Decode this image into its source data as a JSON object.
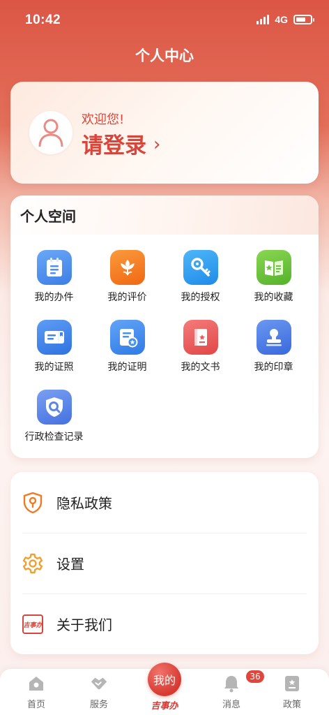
{
  "status": {
    "time": "10:42",
    "network": "4G",
    "battery_level": 0.7
  },
  "header": {
    "title": "个人中心"
  },
  "login": {
    "greeting": "欢迎您!",
    "action": "请登录",
    "arrow": "›"
  },
  "space": {
    "title": "个人空间",
    "items": [
      {
        "label": "我的办件",
        "icon": "document-list-icon",
        "color": "#4f8ff0"
      },
      {
        "label": "我的评价",
        "icon": "flower-icon",
        "color": "#f4781f"
      },
      {
        "label": "我的授权",
        "icon": "key-icon",
        "color": "#2f9ef0"
      },
      {
        "label": "我的收藏",
        "icon": "bookmark-book-icon",
        "color": "#6cc23a"
      },
      {
        "label": "我的证照",
        "icon": "id-card-icon",
        "color": "#3f86ea"
      },
      {
        "label": "我的证明",
        "icon": "certificate-icon",
        "color": "#4692ee"
      },
      {
        "label": "我的文书",
        "icon": "red-book-icon",
        "color": "#ec5a5a"
      },
      {
        "label": "我的印章",
        "icon": "stamp-icon",
        "color": "#4e7fe6"
      },
      {
        "label": "行政检查记录",
        "icon": "shield-search-icon",
        "color": "#5a86e8"
      }
    ]
  },
  "menu": {
    "items": [
      {
        "label": "隐私政策",
        "icon": "privacy-shield-icon"
      },
      {
        "label": "设置",
        "icon": "gear-icon"
      },
      {
        "label": "关于我们",
        "icon": "jishiban-logo-icon",
        "logo_text": "吉事办"
      }
    ]
  },
  "tabbar": {
    "home": "首页",
    "service": "服务",
    "center_top": "我的",
    "center_bottom": "吉事办",
    "messages": "消息",
    "messages_badge": "36",
    "policy": "政策"
  },
  "colors": {
    "brand_red": "#d8453a",
    "accent_orange": "#f0a030"
  }
}
